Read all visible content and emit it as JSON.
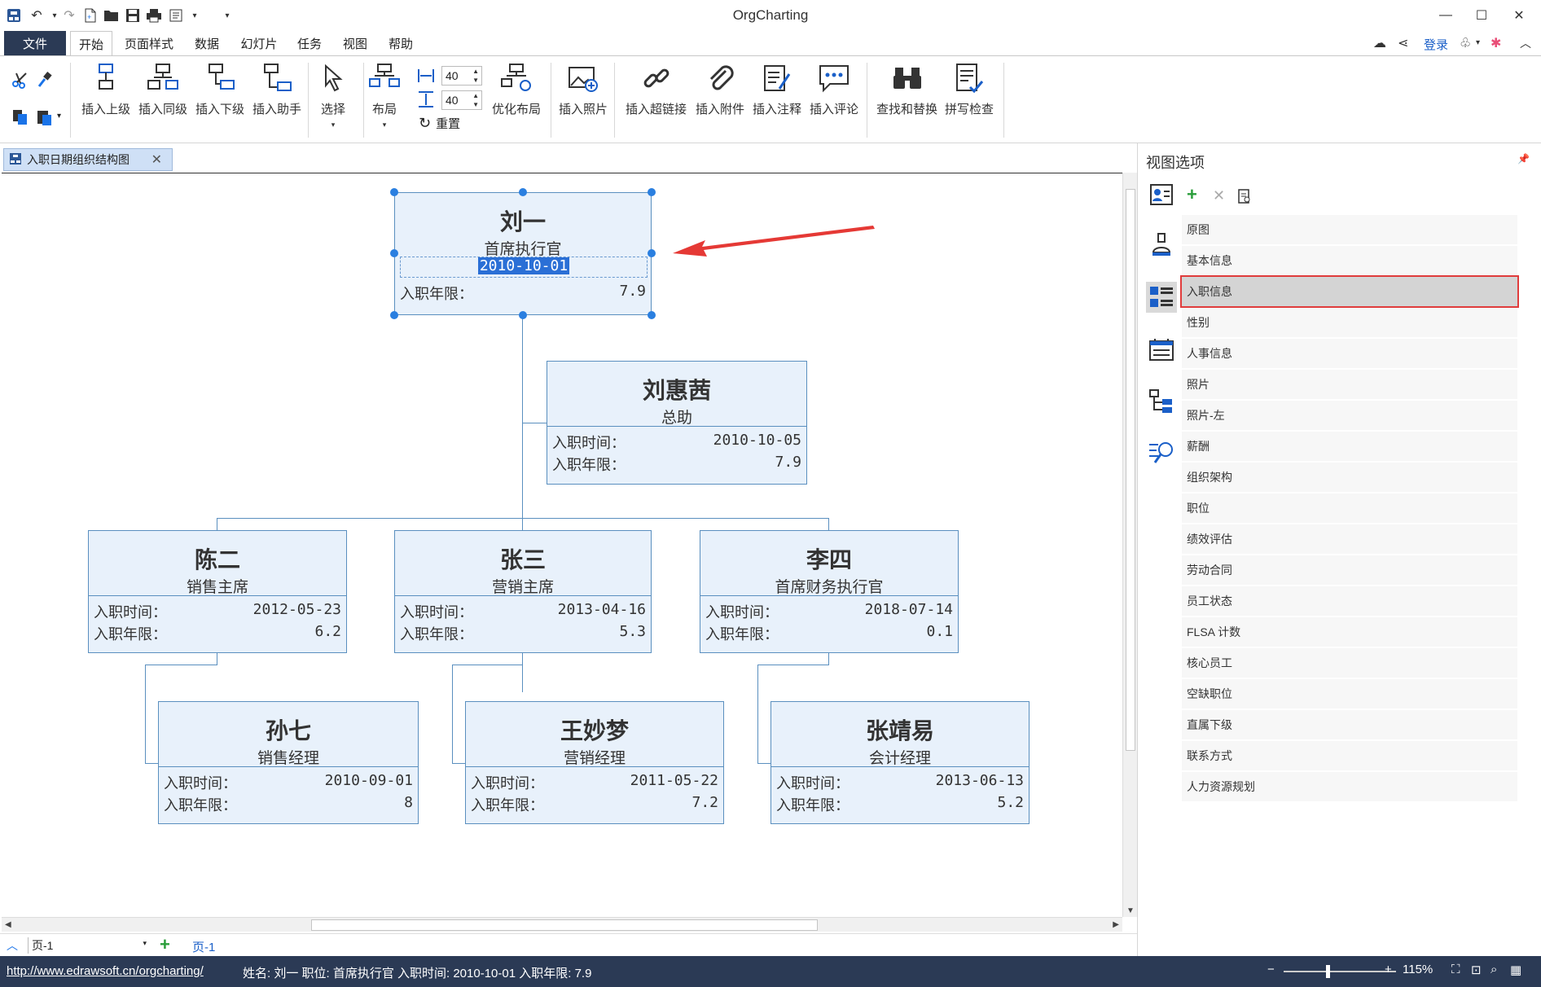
{
  "app": {
    "title": "OrgCharting"
  },
  "menu": {
    "file": "文件",
    "tabs": [
      "开始",
      "页面样式",
      "数据",
      "幻灯片",
      "任务",
      "视图",
      "帮助"
    ],
    "login": "登录"
  },
  "ribbon": {
    "insert_upper": "插入上级",
    "insert_same": "插入同级",
    "insert_lower": "插入下级",
    "insert_assistant": "插入助手",
    "select": "选择",
    "layout": "布局",
    "spacing_h": "40",
    "spacing_v": "40",
    "reset": "重置",
    "optimize": "优化布局",
    "insert_photo": "插入照片",
    "insert_link": "插入超链接",
    "insert_attach": "插入附件",
    "insert_note": "插入注释",
    "insert_comment": "插入评论",
    "find_replace": "查找和替换",
    "spell_check": "拼写检查"
  },
  "doc_tab": "入职日期组织结构图",
  "labels": {
    "hire_date": "入职时间：",
    "tenure": "入职年限："
  },
  "nodes": {
    "n1": {
      "name": "刘一",
      "position": "首席执行官",
      "date": "2010-10-01",
      "tenure": "7.9"
    },
    "n2": {
      "name": "刘惠茜",
      "position": "总助",
      "date": "2010-10-05",
      "tenure": "7.9"
    },
    "n3": {
      "name": "陈二",
      "position": "销售主席",
      "date": "2012-05-23",
      "tenure": "6.2"
    },
    "n4": {
      "name": "张三",
      "position": "营销主席",
      "date": "2013-04-16",
      "tenure": "5.3"
    },
    "n5": {
      "name": "李四",
      "position": "首席财务执行官",
      "date": "2018-07-14",
      "tenure": "0.1"
    },
    "n6": {
      "name": "孙七",
      "position": "销售经理",
      "date": "2010-09-01",
      "tenure": "8"
    },
    "n7": {
      "name": "王妙梦",
      "position": "营销经理",
      "date": "2011-05-22",
      "tenure": "7.2"
    },
    "n8": {
      "name": "张靖易",
      "position": "会计经理",
      "date": "2013-06-13",
      "tenure": "5.2"
    }
  },
  "pages": {
    "selector": "页-1",
    "active": "页-1"
  },
  "panel": {
    "title": "视图选项",
    "items": [
      "原图",
      "基本信息",
      "入职信息",
      "性别",
      "人事信息",
      "照片",
      "照片-左",
      "薪酬",
      "组织架构",
      "职位",
      "绩效评估",
      "劳动合同",
      "员工状态",
      "FLSA 计数",
      "核心员工",
      "空缺职位",
      "直属下级",
      "联系方式",
      "人力资源规划"
    ],
    "selected_index": 2
  },
  "status": {
    "link": "http://www.edrawsoft.cn/orgcharting/",
    "info": "姓名: 刘一  职位: 首席执行官  入职时间: 2010-10-01  入职年限: 7.9",
    "zoom": "115%"
  },
  "colors": {
    "accent": "#2b3a55",
    "node_fill": "#e8f1fb",
    "node_border": "#5a8fbf",
    "highlight": "#e03c3c",
    "arrow": "#e53935"
  }
}
